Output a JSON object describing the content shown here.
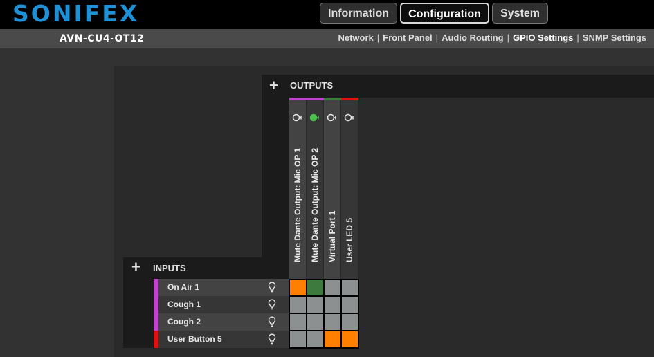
{
  "brand": {
    "logo_text": "SONIFEX",
    "logo_color": "#1e90d6"
  },
  "main_tabs": [
    {
      "label": "Information",
      "active": false
    },
    {
      "label": "Configuration",
      "active": true
    },
    {
      "label": "System",
      "active": false
    }
  ],
  "device_name": "AVN-CU4-OT12",
  "sub_nav": {
    "items": [
      {
        "label": "Network",
        "active": false
      },
      {
        "label": "Front Panel",
        "active": false
      },
      {
        "label": "Audio Routing",
        "active": false
      },
      {
        "label": "GPIO Settings",
        "active": true
      },
      {
        "label": "SNMP Settings",
        "active": false
      }
    ],
    "separator": "|"
  },
  "outputs": {
    "title": "OUTPUTS",
    "add_icon": "plus-icon",
    "columns": [
      {
        "label": "Mute Dante Output: Mic OP 1",
        "bar_color": "#c040d0",
        "icon": "led-icon",
        "icon_state": "off"
      },
      {
        "label": "Mute Dante Output: Mic OP 2",
        "bar_color": "#c040d0",
        "icon": "led-icon",
        "icon_state": "on"
      },
      {
        "label": "Virtual Port 1",
        "bar_color": "#3d7a3d",
        "icon": "led-icon",
        "icon_state": "off"
      },
      {
        "label": "User LED 5",
        "bar_color": "#e01010",
        "icon": "led-icon",
        "icon_state": "off"
      }
    ]
  },
  "inputs": {
    "title": "INPUTS",
    "add_icon": "plus-icon",
    "rows": [
      {
        "label": "On Air 1",
        "bar_color": "#c040d0",
        "icon": "lightbulb-icon"
      },
      {
        "label": "Cough 1",
        "bar_color": "#c040d0",
        "icon": "lightbulb-icon"
      },
      {
        "label": "Cough 2",
        "bar_color": "#c040d0",
        "icon": "lightbulb-icon"
      },
      {
        "label": "User Button 5",
        "bar_color": "#e01010",
        "icon": "lightbulb-icon"
      }
    ]
  },
  "matrix": [
    [
      "on",
      "green",
      "off",
      "off"
    ],
    [
      "off",
      "off",
      "off",
      "off"
    ],
    [
      "off",
      "off",
      "off",
      "off"
    ],
    [
      "off",
      "off",
      "on",
      "on"
    ]
  ],
  "colors": {
    "active_cell": "#ff8000",
    "linked_cell": "#3d7a3d",
    "inactive_cell": "#8c9090",
    "led_on": "#4cc04c"
  }
}
